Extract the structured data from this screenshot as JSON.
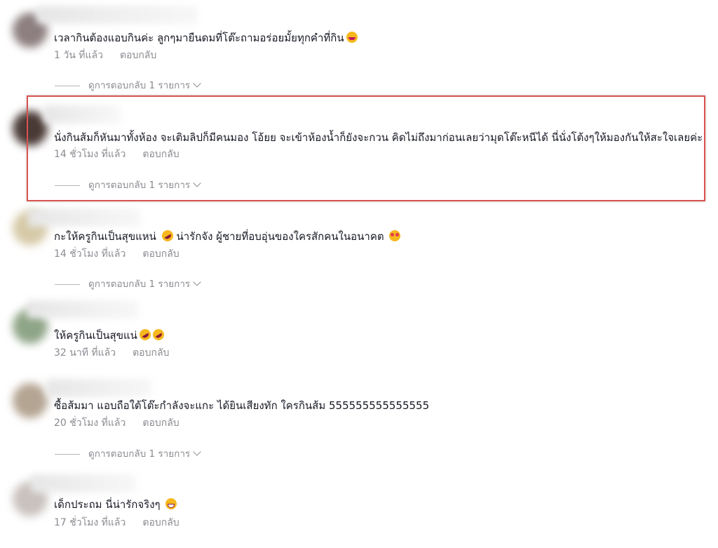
{
  "comments": [
    {
      "text": "เวลากินต้องแอบกินค่ะ ลูกๆมายืนดมที่โต๊ะถามอร่อยมั้ยทุกคำที่กิน",
      "emoji": "laughing-face-icon",
      "time": "1 วัน ที่แล้ว",
      "reply": "ตอบกลับ",
      "view_replies": "ดูการตอบกลับ 1 รายการ"
    },
    {
      "text": "นั่งกินส้มก็หันมาทั้งห้อง จะเติมลิปก็มีคนมอง โอ้ยย จะเข้าห้องน้ำก็ยังจะกวน คิดไม่ถึงมาก่อนเลยว่ามุดโต๊ะหนีได้ นี่นั่งโต้งๆให้มองกันให้สะใจเลยค่ะ",
      "time": "14 ชั่วโมง ที่แล้ว",
      "reply": "ตอบกลับ",
      "view_replies": "ดูการตอบกลับ 1 รายการ"
    },
    {
      "text_a": "กะให้ครูกินเป็นสุขแหน่",
      "text_b": "น่ารักจัง ผู้ชายที่อบอุ่นของใครสักคนในอนาคต",
      "emoji_a": "rolling-laughing-face-icon",
      "emoji_b": "smiling-face-with-hearts-icon",
      "time": "14 ชั่วโมง ที่แล้ว",
      "reply": "ตอบกลับ",
      "view_replies": "ดูการตอบกลับ 1 รายการ"
    },
    {
      "text": "ให้ครูกินเป็นสุขแน่",
      "emoji": "rolling-laughing-face-icon",
      "time": "32 นาที ที่แล้ว",
      "reply": "ตอบกลับ"
    },
    {
      "text": "ซื้อส้มมา แอบถือใต้โต๊ะกำลังจะแกะ ได้ยินเสียงทัก ใครกินส้ม 555555555555555",
      "time": "20 ชั่วโมง ที่แล้ว",
      "reply": "ตอบกลับ",
      "view_replies": "ดูการตอบกลับ 1 รายการ"
    },
    {
      "text": "เด็กประถม นี่น่ารักจริงๆ",
      "emoji": "grinning-face-icon",
      "time": "17 ชั่วโมง ที่แล้ว",
      "reply": "ตอบกลับ"
    }
  ],
  "colors": {
    "text": "#161823",
    "meta": "#8a8b91",
    "highlight_border": "#d9534f"
  }
}
